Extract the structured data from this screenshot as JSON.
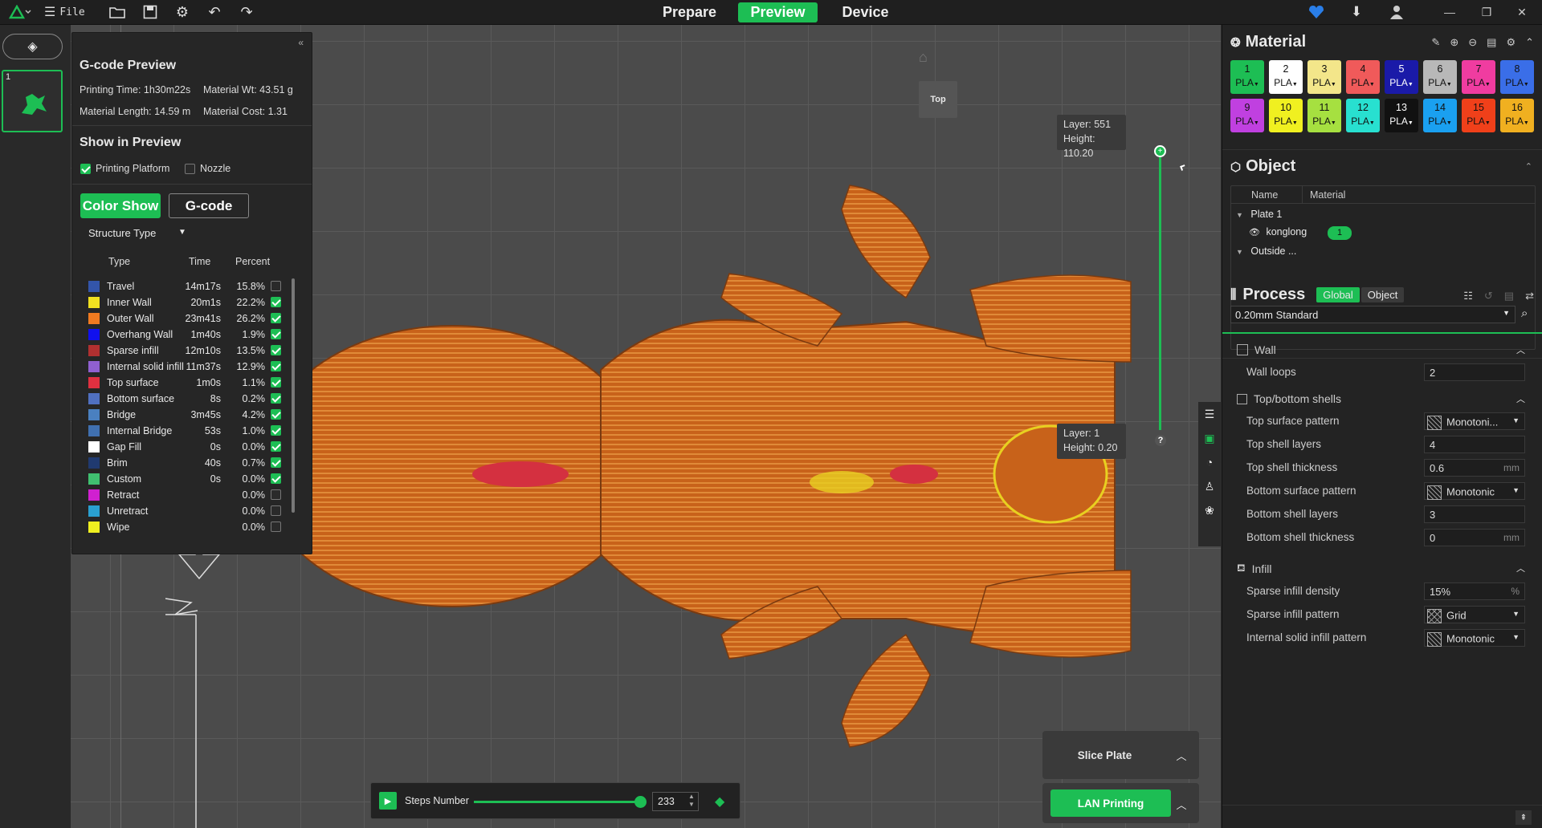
{
  "topbar": {
    "file_label": "File",
    "tabs": [
      "Prepare",
      "Preview",
      "Device"
    ],
    "active_tab": "Preview"
  },
  "plate_list": {
    "plate_number": "1"
  },
  "gcode_panel": {
    "title": "G-code Preview",
    "printing_time": "Printing Time: 1h30m22s",
    "material_wt": "Material Wt: 43.51 g",
    "material_length": "Material Length: 14.59 m",
    "material_cost": "Material Cost: 1.31",
    "show_heading": "Show in Preview",
    "printing_platform": "Printing Platform",
    "nozzle": "Nozzle",
    "color_show": "Color Show",
    "gcode_btn": "G-code",
    "structure_type": "Structure Type",
    "col_type": "Type",
    "col_time": "Time",
    "col_percent": "Percent",
    "rows": [
      {
        "color": "#3355aa",
        "name": "Travel",
        "time": "14m17s",
        "pct": "15.8%",
        "on": false
      },
      {
        "color": "#f0e020",
        "name": "Inner Wall",
        "time": "20m1s",
        "pct": "22.2%",
        "on": true
      },
      {
        "color": "#f07a20",
        "name": "Outer Wall",
        "time": "23m41s",
        "pct": "26.2%",
        "on": true
      },
      {
        "color": "#1010ee",
        "name": "Overhang Wall",
        "time": "1m40s",
        "pct": "1.9%",
        "on": true
      },
      {
        "color": "#b03030",
        "name": "Sparse infill",
        "time": "12m10s",
        "pct": "13.5%",
        "on": true
      },
      {
        "color": "#9060d0",
        "name": "Internal solid infill",
        "time": "11m37s",
        "pct": "12.9%",
        "on": true
      },
      {
        "color": "#e03040",
        "name": "Top surface",
        "time": "1m0s",
        "pct": "1.1%",
        "on": true
      },
      {
        "color": "#5070c0",
        "name": "Bottom surface",
        "time": "8s",
        "pct": "0.2%",
        "on": true
      },
      {
        "color": "#4a80c0",
        "name": "Bridge",
        "time": "3m45s",
        "pct": "4.2%",
        "on": true
      },
      {
        "color": "#4070b0",
        "name": "Internal Bridge",
        "time": "53s",
        "pct": "1.0%",
        "on": true
      },
      {
        "color": "#ffffff",
        "name": "Gap Fill",
        "time": "0s",
        "pct": "0.0%",
        "on": true
      },
      {
        "color": "#203a70",
        "name": "Brim",
        "time": "40s",
        "pct": "0.7%",
        "on": true
      },
      {
        "color": "#40c070",
        "name": "Custom",
        "time": "0s",
        "pct": "0.0%",
        "on": true
      },
      {
        "color": "#d020d0",
        "name": "Retract",
        "time": "",
        "pct": "0.0%",
        "on": false
      },
      {
        "color": "#2aa0d0",
        "name": "Unretract",
        "time": "",
        "pct": "0.0%",
        "on": false
      },
      {
        "color": "#f0f020",
        "name": "Wipe",
        "time": "",
        "pct": "0.0%",
        "on": false
      }
    ]
  },
  "viewport": {
    "top_label": "Top",
    "layer_top": "Layer: 551",
    "height_top": "Height: 110.20",
    "layer_bottom": "Layer: 1",
    "height_bottom": "Height: 0.20",
    "slider_top_pct": 100,
    "steps_label": "Steps Number",
    "steps_value": "233",
    "steps_pct": 100,
    "slice_plate": "Slice Plate",
    "lan_printing": "LAN Printing",
    "help": "?"
  },
  "material": {
    "title": "Material",
    "filaments": [
      {
        "n": "1",
        "t": "PLA",
        "bg": "#1dbe54",
        "fg": "#111"
      },
      {
        "n": "2",
        "t": "PLA",
        "bg": "#ffffff",
        "fg": "#111"
      },
      {
        "n": "3",
        "t": "PLA",
        "bg": "#f3e68a",
        "fg": "#111"
      },
      {
        "n": "4",
        "t": "PLA",
        "bg": "#f05a5a",
        "fg": "#111"
      },
      {
        "n": "5",
        "t": "PLA",
        "bg": "#1a1aa8",
        "fg": "#fff"
      },
      {
        "n": "6",
        "t": "PLA",
        "bg": "#b8b8b8",
        "fg": "#111"
      },
      {
        "n": "7",
        "t": "PLA",
        "bg": "#f03ca0",
        "fg": "#111"
      },
      {
        "n": "8",
        "t": "PLA",
        "bg": "#3a6ee8",
        "fg": "#111"
      },
      {
        "n": "9",
        "t": "PLA",
        "bg": "#c040e0",
        "fg": "#111"
      },
      {
        "n": "10",
        "t": "PLA",
        "bg": "#f0f020",
        "fg": "#111"
      },
      {
        "n": "11",
        "t": "PLA",
        "bg": "#a6e040",
        "fg": "#111"
      },
      {
        "n": "12",
        "t": "PLA",
        "bg": "#28e0d0",
        "fg": "#111"
      },
      {
        "n": "13",
        "t": "PLA",
        "bg": "#111111",
        "fg": "#fff"
      },
      {
        "n": "14",
        "t": "PLA",
        "bg": "#1aa0f0",
        "fg": "#111"
      },
      {
        "n": "15",
        "t": "PLA",
        "bg": "#f0401a",
        "fg": "#111"
      },
      {
        "n": "16",
        "t": "PLA",
        "bg": "#f0b020",
        "fg": "#111"
      }
    ]
  },
  "object": {
    "title": "Object",
    "col_name": "Name",
    "col_material": "Material",
    "plate": "Plate 1",
    "item": "konglong",
    "item_mat": "1",
    "outside": "Outside ..."
  },
  "process": {
    "title": "Process",
    "global": "Global",
    "object": "Object",
    "preset": "0.20mm Standard",
    "wall": "Wall",
    "wall_loops_lbl": "Wall loops",
    "wall_loops": "2",
    "tb": "Top/bottom shells",
    "top_pattern_lbl": "Top surface pattern",
    "top_pattern": "Monotoni...",
    "top_layers_lbl": "Top shell layers",
    "top_layers": "4",
    "top_thick_lbl": "Top shell thickness",
    "top_thick": "0.6",
    "bot_pattern_lbl": "Bottom surface pattern",
    "bot_pattern": "Monotonic",
    "bot_layers_lbl": "Bottom shell layers",
    "bot_layers": "3",
    "bot_thick_lbl": "Bottom shell thickness",
    "bot_thick": "0",
    "infill": "Infill",
    "density_lbl": "Sparse infill density",
    "density": "15%",
    "sparse_pattern_lbl": "Sparse infill pattern",
    "sparse_pattern": "Grid",
    "internal_pattern_lbl": "Internal solid infill pattern",
    "internal_pattern": "Monotonic",
    "unit_mm": "mm",
    "unit_pct": "%"
  }
}
